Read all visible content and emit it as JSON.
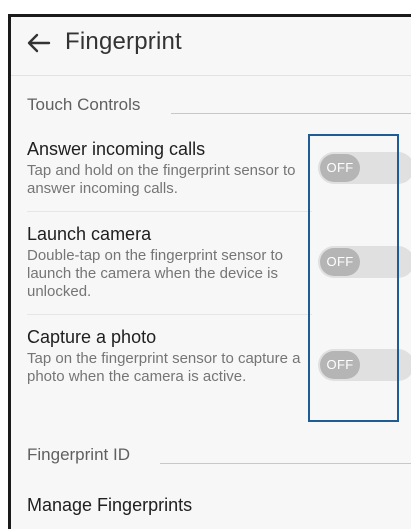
{
  "header": {
    "title": "Fingerprint"
  },
  "sections": {
    "touch_controls": "Touch Controls",
    "fingerprint_id": "Fingerprint ID"
  },
  "items": [
    {
      "title": "Answer incoming calls",
      "description": "Tap and hold on the fingerprint sensor to answer incoming calls.",
      "toggle_state": "OFF"
    },
    {
      "title": "Launch camera",
      "description": "Double-tap on the fingerprint sensor to launch the camera when the device is unlocked.",
      "toggle_state": "OFF"
    },
    {
      "title": "Capture a photo",
      "description": "Tap on the fingerprint sensor to capture a photo when the camera is active.",
      "toggle_state": "OFF"
    }
  ],
  "manage": {
    "label": "Manage Fingerprints"
  },
  "colors": {
    "highlight_box": "#1f5c96",
    "toggle_track": "#e0e0e0",
    "toggle_knob": "#b5b5b5"
  },
  "icons": {
    "back": "back-arrow-icon"
  }
}
